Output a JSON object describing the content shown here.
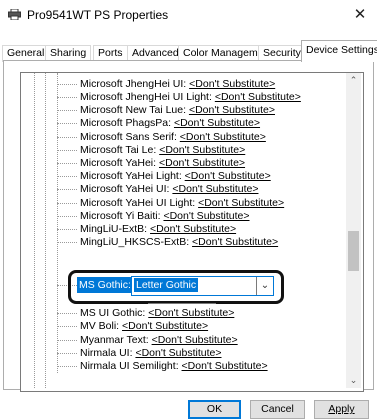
{
  "window": {
    "title": "Pro9541WT PS Properties",
    "close_symbol": "✕"
  },
  "tabs": [
    {
      "label": "General"
    },
    {
      "label": "Sharing"
    },
    {
      "label": "Ports"
    },
    {
      "label": "Advanced"
    },
    {
      "label": "Color Management"
    },
    {
      "label": "Security"
    },
    {
      "label": "Device Settings"
    }
  ],
  "active_tab": "Device Settings",
  "font_rows_above": [
    {
      "name": "Microsoft JhengHei UI:",
      "value": "<Don't Substitute>"
    },
    {
      "name": "Microsoft JhengHei UI Light:",
      "value": "<Don't Substitute>"
    },
    {
      "name": "Microsoft New Tai Lue:",
      "value": "<Don't Substitute>"
    },
    {
      "name": "Microsoft PhagsPa:",
      "value": "<Don't Substitute>"
    },
    {
      "name": "Microsoft Sans Serif:",
      "value": "<Don't Substitute>"
    },
    {
      "name": "Microsoft Tai Le:",
      "value": "<Don't Substitute>"
    },
    {
      "name": "Microsoft YaHei:",
      "value": "<Don't Substitute>"
    },
    {
      "name": "Microsoft YaHei Light:",
      "value": "<Don't Substitute>"
    },
    {
      "name": "Microsoft YaHei UI:",
      "value": "<Don't Substitute>"
    },
    {
      "name": "Microsoft YaHei UI Light:",
      "value": "<Don't Substitute>"
    },
    {
      "name": "Microsoft Yi Baiti:",
      "value": "<Don't Substitute>"
    },
    {
      "name": "MingLiU-ExtB:",
      "value": "<Don't Substitute>"
    },
    {
      "name": "MingLiU_HKSCS-ExtB:",
      "value": "<Don't Substitute>"
    }
  ],
  "selected_row": {
    "name": "MS Gothic:",
    "value": "Letter Gothic"
  },
  "font_rows_below": [
    {
      "name": "MS UI Gothic:",
      "value": "<Don't Substitute>"
    },
    {
      "name": "MV Boli:",
      "value": "<Don't Substitute>"
    },
    {
      "name": "Myanmar Text:",
      "value": "<Don't Substitute>"
    },
    {
      "name": "Nirmala UI:",
      "value": "<Don't Substitute>"
    },
    {
      "name": "Nirmala UI Semilight:",
      "value": "<Don't Substitute>"
    }
  ],
  "buttons": {
    "ok": "OK",
    "cancel": "Cancel",
    "apply": "Apply"
  },
  "icons": {
    "window_icon": "printer-icon",
    "scroll_up": "chevron-up-icon",
    "scroll_down": "chevron-down-icon",
    "combo_arrow": "chevron-down-icon"
  },
  "colors": {
    "selection": "#0078d7",
    "highlight_ring": "#111111"
  }
}
